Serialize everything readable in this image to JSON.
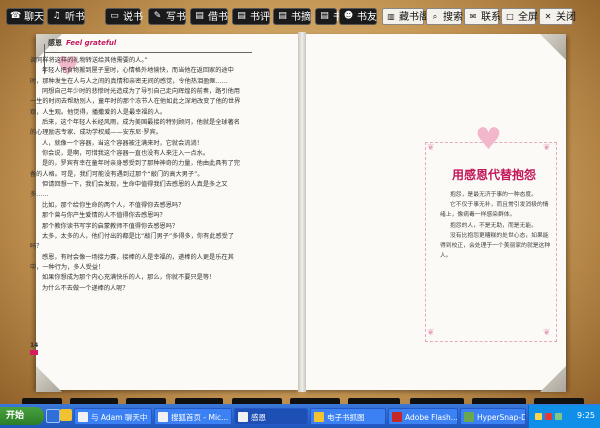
{
  "toolbar": {
    "left_buttons": [
      {
        "label": "聊天",
        "icon": "chat-icon"
      },
      {
        "label": "听书",
        "icon": "headphones-icon"
      },
      {
        "label": "说书",
        "icon": "mic-icon"
      },
      {
        "label": "写书",
        "icon": "pen-icon"
      },
      {
        "label": "借书",
        "icon": "book-icon"
      },
      {
        "label": "书评",
        "icon": "review-icon"
      },
      {
        "label": "书摘",
        "icon": "excerpt-icon"
      },
      {
        "label": "书讯",
        "icon": "news-icon"
      },
      {
        "label": "书友",
        "icon": "friends-icon"
      }
    ],
    "right_buttons": [
      {
        "label": "藏书阁",
        "icon": "library-icon"
      },
      {
        "label": "搜索",
        "icon": "search-icon"
      },
      {
        "label": "联系",
        "icon": "contact-icon"
      },
      {
        "label": "全屏",
        "icon": "fullscreen-icon"
      },
      {
        "label": "关闭",
        "icon": "close-icon"
      }
    ]
  },
  "left_page": {
    "header_cn": "感恩",
    "header_en": "Feel grateful",
    "paragraphs": [
      "调同样将这样的礼物转送给其他需要的人。”",
      "年轻人把食物搬到屋子里时，心情格外地愉快，而当他在返回家的途中时，那种发生在人与人之间的真情和亲密无间的感觉，令他热泪盈眶……",
      "同想自己年少时的悲惨时光造成为了导引自己走向辉煌的前奏，路引他用一生的时间去帮助别人，童年时的那个冻节人在他如此之深地改变了他的世界观，人生观。他觉得，播撒爱的人是最幸福的人。",
      "后来，这个年轻人长经风雨，成为美国最接的特别顾问，他就是全球著名的心理励志专家、成功学权威——安东尼·罗宾。",
      "人，就像一个容器，当这个容器被注满来时，它就会流淌！",
      "你会说，是啊，可惜我这个容器一直也没有人来注入一点水。",
      "是的，罗宾有幸在童年时亲身感受到了那种神奇的力量，他由此具有了完备的人格。可是，我们可能没有遇到过那个“敲门的高大男子”。",
      "但请回想一下，我们会发现，生命中值得我们去感恩的人真是多之又多……",
      "比如，那个给你生命的两个人，不值得你去感恩吗？",
      "那个曾与你产生爱情的人不值得你去感恩吗？",
      "那个教你读书写字的启蒙教师不值得你去感恩吗？",
      "太多，太多的人，他们付出的都是比“敲门男子”多得多，你有此感受了吗？",
      "感恩，有时会像一场接力赛，接棒的人是幸福的，递棒的人更是乐在其中，一种行为，多人受益！",
      "如果你想成为那个内心充满快乐的人，那么，你就不要只是等！",
      "为什么不去做一个递棒的人呢？"
    ],
    "page_number": "14"
  },
  "right_page": {
    "title": "用感恩代替抱怨",
    "paragraphs": [
      "抱怨，是最无济于事的一种态度。",
      "它不仅于事无补，而且常引发消极的情绪上，像病毒一样感染群体。",
      "抱怨的人，不是无助，而是无能。",
      "没有比抱怨更糟糕的处世心态，如果能得到校正，会处理于一个美丽家的就是这种人。"
    ]
  },
  "taskbar": {
    "start_label": "开始",
    "tasks": [
      {
        "label": "与 Adam 聊天中",
        "active": false
      },
      {
        "label": "搜狐首页 - Mic...",
        "active": false
      },
      {
        "label": "感恩",
        "active": true
      },
      {
        "label": "电子书抓图",
        "active": false
      },
      {
        "label": "Adobe Flash...",
        "active": false
      },
      {
        "label": "HyperSnap-D...",
        "active": false
      }
    ],
    "clock": "9:25"
  }
}
